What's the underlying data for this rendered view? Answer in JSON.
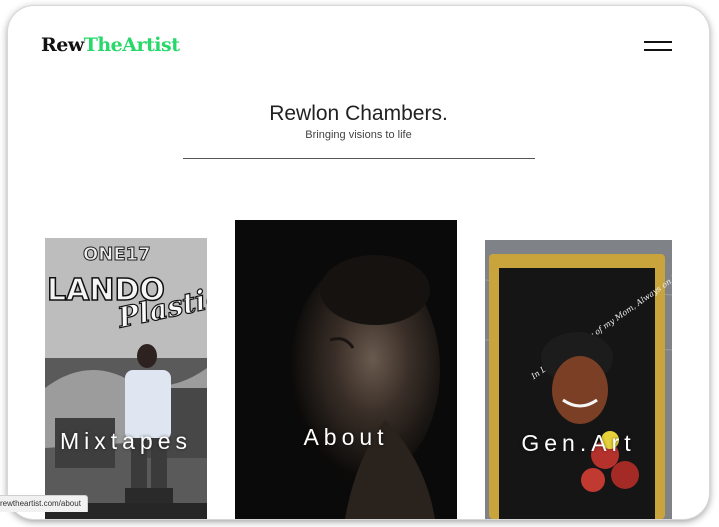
{
  "header": {
    "logo_part1": "Rew",
    "logo_part2": "TheArtist",
    "menu_icon": "hamburger-menu-icon"
  },
  "hero": {
    "title": "Rewlon Chambers.",
    "tagline": "Bringing visions to life"
  },
  "cards": [
    {
      "label": "Mixtapes",
      "cover_text_1": "ONE17",
      "cover_text_2": "LANDO",
      "cover_text_3": "Plastic"
    },
    {
      "label": "About"
    },
    {
      "label": "Gen.Art",
      "frame_text": "In Loving Memory of my Mom, Always on My Mind Forever In My Heart."
    }
  ],
  "status_bar": {
    "url": "rewtheartist.com/about"
  },
  "colors": {
    "brand_green": "#27d86a",
    "text_dark": "#111111"
  }
}
